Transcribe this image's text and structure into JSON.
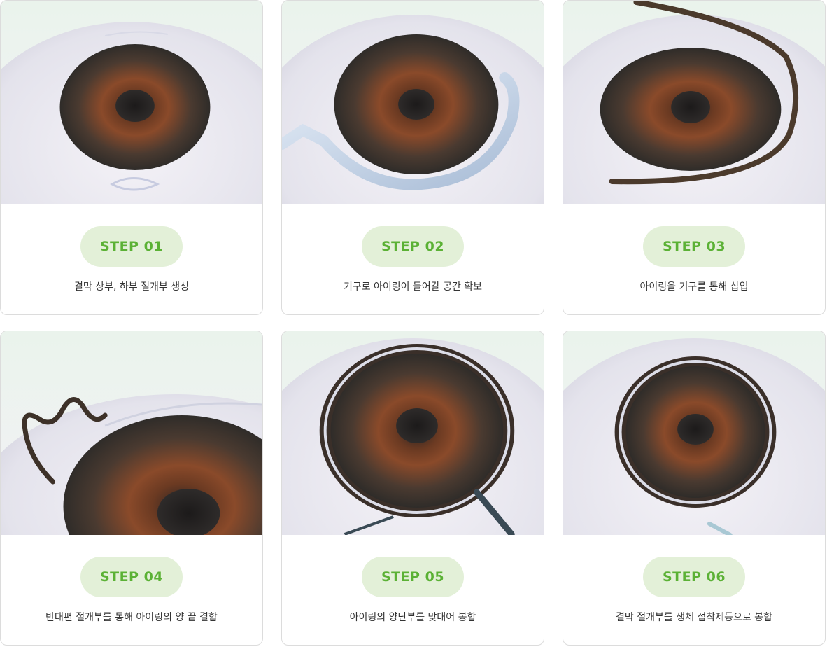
{
  "steps": [
    {
      "badge": "STEP 01",
      "description": "결막 상부, 하부 절개부 생성"
    },
    {
      "badge": "STEP 02",
      "description": "기구로 아이링이 들어갈 공간 확보"
    },
    {
      "badge": "STEP 03",
      "description": "아이링을 기구를 통해 삽입"
    },
    {
      "badge": "STEP 04",
      "description": "반대편 절개부를 통해 아이링의 양 끝 결합"
    },
    {
      "badge": "STEP 05",
      "description": "아이링의 양단부를 맞대어 봉합"
    },
    {
      "badge": "STEP 06",
      "description": "결막 절개부를 생체 접착제등으로 봉합"
    }
  ],
  "colors": {
    "badge_bg": "#e3f0d8",
    "badge_text": "#5bb135",
    "description_text": "#333333",
    "card_border": "#dcdcdc"
  }
}
